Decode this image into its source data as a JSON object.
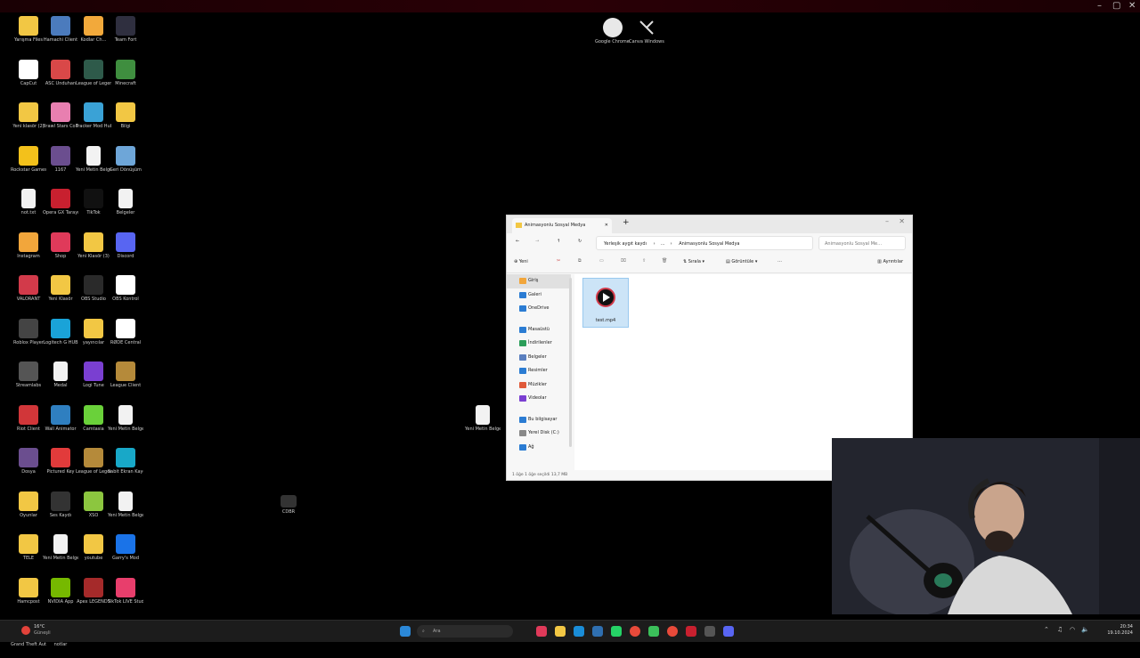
{
  "desktop": {
    "icons": [
      {
        "label": "Yarışma Files",
        "color": "#f2c744",
        "type": "folder"
      },
      {
        "label": "Hamachi Client",
        "color": "#4b7bbd",
        "type": "app"
      },
      {
        "label": "Kodlar Ch…",
        "color": "#f2a93b",
        "type": "app"
      },
      {
        "label": "Team Fort",
        "color": "#2f2f3f",
        "type": "app"
      },
      {
        "label": "CapCut",
        "color": "#ffffff",
        "type": "app"
      },
      {
        "label": "ASC Unduhan",
        "color": "#d94848",
        "type": "app"
      },
      {
        "label": "League of Legends PBE",
        "color": "#2e5a4a",
        "type": "app"
      },
      {
        "label": "Minecraft",
        "color": "#3f8e3f",
        "type": "app"
      },
      {
        "label": "Yeni klasör (2)",
        "color": "#f2c744",
        "type": "folder"
      },
      {
        "label": "Brawl Stars Collection",
        "color": "#e87fb0",
        "type": "app"
      },
      {
        "label": "Tracker Mod Hub",
        "color": "#3aa2d6",
        "type": "app"
      },
      {
        "label": "Bilgi",
        "color": "#f2c744",
        "type": "folder"
      },
      {
        "label": "Rockstar Games",
        "color": "#f3c11b",
        "type": "app"
      },
      {
        "label": "1167",
        "color": "#6b4e8f",
        "type": "app"
      },
      {
        "label": "Yeni Metin Belgesi",
        "color": "#f2f2f2",
        "type": "doc"
      },
      {
        "label": "Geri Dönüşüm",
        "color": "#6ea6d8",
        "type": "app"
      },
      {
        "label": "not.txt",
        "color": "#f2f2f2",
        "type": "doc"
      },
      {
        "label": "Opera GX Tarayıcı",
        "color": "#c8202f",
        "type": "app"
      },
      {
        "label": "TikTok",
        "color": "#111111",
        "type": "app"
      },
      {
        "label": "Belgeler",
        "color": "#f2f2f2",
        "type": "doc"
      },
      {
        "label": "Instagram",
        "color": "#f2a63b",
        "type": "folder"
      },
      {
        "label": "Shop",
        "color": "#e03a5a",
        "type": "app"
      },
      {
        "label": "Yeni Klasör (3)",
        "color": "#f2c744",
        "type": "folder"
      },
      {
        "label": "Discord",
        "color": "#5865f2",
        "type": "app"
      },
      {
        "label": "VALORANT",
        "color": "#d23a4a",
        "type": "app"
      },
      {
        "label": "Yeni Klasör",
        "color": "#f2c744",
        "type": "folder"
      },
      {
        "label": "OBS Studio",
        "color": "#2a2a2a",
        "type": "app"
      },
      {
        "label": "OBS Kontrol",
        "color": "#ffffff",
        "type": "app"
      },
      {
        "label": "Roblox Player",
        "color": "#444444",
        "type": "app"
      },
      {
        "label": "Logitech G HUB",
        "color": "#1aa3d8",
        "type": "app"
      },
      {
        "label": "yayıncılar",
        "color": "#f2c744",
        "type": "folder"
      },
      {
        "label": "RØDE Central",
        "color": "#ffffff",
        "type": "app"
      },
      {
        "label": "Streamlabs",
        "color": "#555555",
        "type": "app"
      },
      {
        "label": "Medal",
        "color": "#f2f2f2",
        "type": "doc"
      },
      {
        "label": "Logi Tune",
        "color": "#7a3fd1",
        "type": "app"
      },
      {
        "label": "League Client",
        "color": "#b58a3a",
        "type": "app"
      },
      {
        "label": "Riot Client",
        "color": "#d13639",
        "type": "app"
      },
      {
        "label": "Wall Animator",
        "color": "#2f7fc0",
        "type": "app"
      },
      {
        "label": "Camtasia",
        "color": "#6ad13a",
        "type": "app"
      },
      {
        "label": "Yeni Metin Belgesi (2)",
        "color": "#f2f2f2",
        "type": "doc"
      },
      {
        "label": "Dosya",
        "color": "#6b4e8f",
        "type": "app"
      },
      {
        "label": "Pictured Key",
        "color": "#e23b3b",
        "type": "app"
      },
      {
        "label": "League of Legends",
        "color": "#b58a3a",
        "type": "app"
      },
      {
        "label": "Sabit Ekran Kaydı",
        "color": "#18a8c8",
        "type": "app"
      },
      {
        "label": "Oyunlar",
        "color": "#f2c744",
        "type": "folder"
      },
      {
        "label": "Ses Kaydı",
        "color": "#333333",
        "type": "app"
      },
      {
        "label": "XSO",
        "color": "#8cc63f",
        "type": "app"
      },
      {
        "label": "Yeni Metin Belgesi (3)",
        "color": "#f2f2f2",
        "type": "doc"
      },
      {
        "label": "TELE",
        "color": "#f2c744",
        "type": "folder"
      },
      {
        "label": "Yeni Metin Belgesi (4)",
        "color": "#f2f2f2",
        "type": "doc"
      },
      {
        "label": "youtube",
        "color": "#f2c744",
        "type": "folder"
      },
      {
        "label": "Garry's Mod",
        "color": "#1a73e8",
        "type": "app"
      },
      {
        "label": "Hamcpost",
        "color": "#f2c744",
        "type": "folder"
      },
      {
        "label": "NVIDIA App",
        "color": "#76b900",
        "type": "app"
      },
      {
        "label": "Apex LEGENDS",
        "color": "#a52a2a",
        "type": "app"
      },
      {
        "label": "TikTok LIVE Studio",
        "color": "#e83e6c",
        "type": "app"
      },
      {
        "label": "Grand Theft Auto V",
        "color": "#2e8b57",
        "type": "app"
      },
      {
        "label": "notlar",
        "color": "#f2f2f2",
        "type": "doc"
      }
    ],
    "top_icons": [
      {
        "label": "Google Chrome Profil",
        "color": "#e8e8e8"
      },
      {
        "label": "Canva Windows",
        "color": "#dddddd"
      }
    ],
    "mid_doc": {
      "label": "Yeni Metin Belgesi (5)"
    },
    "mid_icon": {
      "label": "CDBR"
    }
  },
  "explorer": {
    "tab_title": "Animasyonlu Sosyal Medya",
    "address_path": [
      "Yerleşik aygıt kaydı",
      "Animasyonlu Sosyal Medya"
    ],
    "search_placeholder": "Animasyonlu Sosyal Me…",
    "toolbar": {
      "new_label": "Yeni",
      "sort_label": "Sırala",
      "view_label": "Görüntüle",
      "more_label": "…",
      "details_label": "Ayrıntılar"
    },
    "nav": [
      {
        "label": "Giriş",
        "color": "#f2a63b",
        "selected": true
      },
      {
        "label": "Galeri",
        "color": "#2b7cd3"
      },
      {
        "label": "OneDrive",
        "color": "#2b7cd3"
      },
      {
        "label": "Masaüstü",
        "color": "#2b7cd3"
      },
      {
        "label": "İndirilenler",
        "color": "#2b9e59"
      },
      {
        "label": "Belgeler",
        "color": "#5a7fbf"
      },
      {
        "label": "Resimler",
        "color": "#2b7cd3"
      },
      {
        "label": "Müzikler",
        "color": "#e05a3a"
      },
      {
        "label": "Videolar",
        "color": "#7a3fd1"
      },
      {
        "label": "Bu bilgisayar",
        "color": "#2b7cd3"
      },
      {
        "label": "Yerel Disk (C:)",
        "color": "#888888"
      },
      {
        "label": "Ağ",
        "color": "#2b7cd3"
      }
    ],
    "file": {
      "name": "test.mp4"
    },
    "status": "1 öğe   1 öğe seçildi  13,7 MB"
  },
  "taskbar": {
    "weather_temp": "16°C",
    "weather_text": "Güneşli",
    "search_placeholder": "Ara",
    "time": "20:34",
    "date": "19.10.2024"
  }
}
